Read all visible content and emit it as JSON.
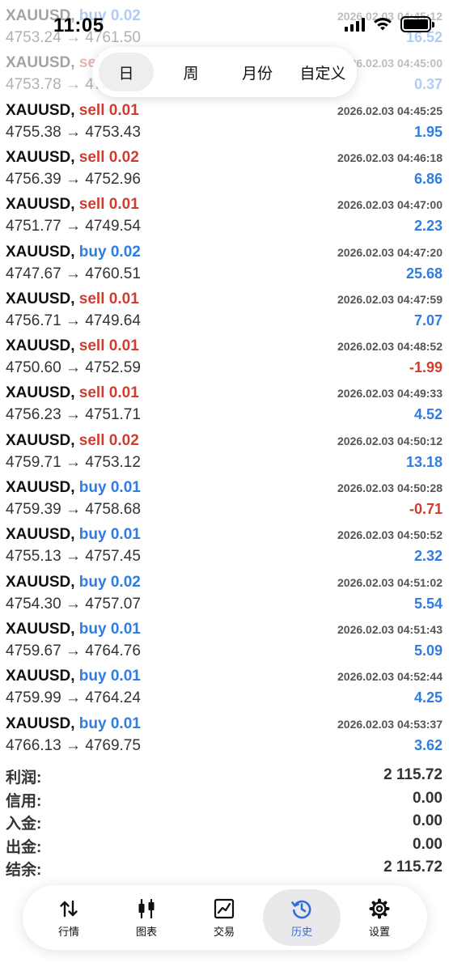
{
  "status_bar": {
    "time": "11:05"
  },
  "period_tabs": [
    {
      "label": "日",
      "active": true
    },
    {
      "label": "周",
      "active": false
    },
    {
      "label": "月份",
      "active": false
    },
    {
      "label": "自定义",
      "active": false
    }
  ],
  "trades": [
    {
      "symbol": "XAUUSD",
      "sep": ", ",
      "side": "buy",
      "volume": "0.02",
      "open_price": "4753.24",
      "arrow": " → ",
      "close_price": "4761.50",
      "time": "2026.02.03 04:45:12",
      "profit": "16.52"
    },
    {
      "symbol": "XAUUSD",
      "sep": ", ",
      "side": "sell",
      "volume": "0.01",
      "open_price": "4753.78",
      "arrow": " → ",
      "close_price": "4753.41",
      "time": "2026.02.03 04:45:00",
      "profit": "0.37"
    },
    {
      "symbol": "XAUUSD",
      "sep": ", ",
      "side": "sell",
      "volume": "0.01",
      "open_price": "4755.38",
      "arrow": " → ",
      "close_price": "4753.43",
      "time": "2026.02.03 04:45:25",
      "profit": "1.95"
    },
    {
      "symbol": "XAUUSD",
      "sep": ", ",
      "side": "sell",
      "volume": "0.02",
      "open_price": "4756.39",
      "arrow": " → ",
      "close_price": "4752.96",
      "time": "2026.02.03 04:46:18",
      "profit": "6.86"
    },
    {
      "symbol": "XAUUSD",
      "sep": ", ",
      "side": "sell",
      "volume": "0.01",
      "open_price": "4751.77",
      "arrow": " → ",
      "close_price": "4749.54",
      "time": "2026.02.03 04:47:00",
      "profit": "2.23"
    },
    {
      "symbol": "XAUUSD",
      "sep": ", ",
      "side": "buy",
      "volume": "0.02",
      "open_price": "4747.67",
      "arrow": " → ",
      "close_price": "4760.51",
      "time": "2026.02.03 04:47:20",
      "profit": "25.68"
    },
    {
      "symbol": "XAUUSD",
      "sep": ", ",
      "side": "sell",
      "volume": "0.01",
      "open_price": "4756.71",
      "arrow": " → ",
      "close_price": "4749.64",
      "time": "2026.02.03 04:47:59",
      "profit": "7.07"
    },
    {
      "symbol": "XAUUSD",
      "sep": ", ",
      "side": "sell",
      "volume": "0.01",
      "open_price": "4750.60",
      "arrow": " → ",
      "close_price": "4752.59",
      "time": "2026.02.03 04:48:52",
      "profit": "-1.99"
    },
    {
      "symbol": "XAUUSD",
      "sep": ", ",
      "side": "sell",
      "volume": "0.01",
      "open_price": "4756.23",
      "arrow": " → ",
      "close_price": "4751.71",
      "time": "2026.02.03 04:49:33",
      "profit": "4.52"
    },
    {
      "symbol": "XAUUSD",
      "sep": ", ",
      "side": "sell",
      "volume": "0.02",
      "open_price": "4759.71",
      "arrow": " → ",
      "close_price": "4753.12",
      "time": "2026.02.03 04:50:12",
      "profit": "13.18"
    },
    {
      "symbol": "XAUUSD",
      "sep": ", ",
      "side": "buy",
      "volume": "0.01",
      "open_price": "4759.39",
      "arrow": " → ",
      "close_price": "4758.68",
      "time": "2026.02.03 04:50:28",
      "profit": "-0.71"
    },
    {
      "symbol": "XAUUSD",
      "sep": ", ",
      "side": "buy",
      "volume": "0.01",
      "open_price": "4755.13",
      "arrow": " → ",
      "close_price": "4757.45",
      "time": "2026.02.03 04:50:52",
      "profit": "2.32"
    },
    {
      "symbol": "XAUUSD",
      "sep": ", ",
      "side": "buy",
      "volume": "0.02",
      "open_price": "4754.30",
      "arrow": " → ",
      "close_price": "4757.07",
      "time": "2026.02.03 04:51:02",
      "profit": "5.54"
    },
    {
      "symbol": "XAUUSD",
      "sep": ", ",
      "side": "buy",
      "volume": "0.01",
      "open_price": "4759.67",
      "arrow": " → ",
      "close_price": "4764.76",
      "time": "2026.02.03 04:51:43",
      "profit": "5.09"
    },
    {
      "symbol": "XAUUSD",
      "sep": ", ",
      "side": "buy",
      "volume": "0.01",
      "open_price": "4759.99",
      "arrow": " → ",
      "close_price": "4764.24",
      "time": "2026.02.03 04:52:44",
      "profit": "4.25"
    },
    {
      "symbol": "XAUUSD",
      "sep": ", ",
      "side": "buy",
      "volume": "0.01",
      "open_price": "4766.13",
      "arrow": " → ",
      "close_price": "4769.75",
      "time": "2026.02.03 04:53:37",
      "profit": "3.62"
    }
  ],
  "summary": [
    {
      "label": "利润:",
      "value": "2 115.72"
    },
    {
      "label": "信用:",
      "value": "0.00"
    },
    {
      "label": "入金:",
      "value": "0.00"
    },
    {
      "label": "出金:",
      "value": "0.00"
    },
    {
      "label": "结余:",
      "value": "2 115.72"
    }
  ],
  "bottom_nav": [
    {
      "label": "行情",
      "icon": "quotes-arrows-icon",
      "active": false
    },
    {
      "label": "图表",
      "icon": "candlestick-chart-icon",
      "active": false
    },
    {
      "label": "交易",
      "icon": "trade-chart-icon",
      "active": false
    },
    {
      "label": "历史",
      "icon": "history-clock-icon",
      "active": true
    },
    {
      "label": "设置",
      "icon": "settings-gear-icon",
      "active": false
    }
  ],
  "colors": {
    "buy": "#2f7de1",
    "sell": "#d23c2f",
    "profit_positive": "#2f7de1",
    "profit_negative": "#d23c2f",
    "active_tab": "#2f6fdc"
  }
}
